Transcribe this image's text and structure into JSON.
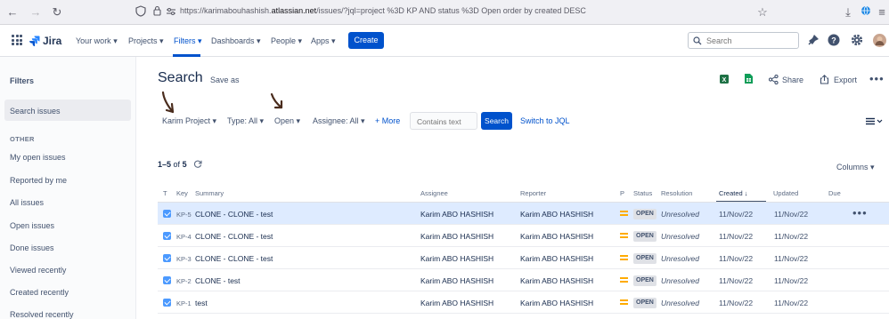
{
  "browser": {
    "url_prefix": "https://karimabouhashish.",
    "url_domain": "atlassian.net",
    "url_rest": "/issues/?jql=project %3D KP AND status %3D Open order by created DESC"
  },
  "nav": {
    "logo": "Jira",
    "your_work": "Your work ▾",
    "projects": "Projects ▾",
    "filters": "Filters ▾",
    "dashboards": "Dashboards ▾",
    "people": "People ▾",
    "apps": "Apps ▾",
    "create": "Create",
    "search_placeholder": "Search"
  },
  "sidebar": {
    "title": "Filters",
    "search_issues": "Search issues",
    "other_heading": "OTHER",
    "items": [
      "My open issues",
      "Reported by me",
      "All issues",
      "Open issues",
      "Done issues",
      "Viewed recently",
      "Created recently",
      "Resolved recently"
    ]
  },
  "main": {
    "title": "Search",
    "save_as": "Save as",
    "share": "Share",
    "export": "Export",
    "filters": {
      "project": "Karim Project ▾",
      "type": "Type: All ▾",
      "status": "Open ▾",
      "assignee": "Assignee: All ▾",
      "more": "+ More",
      "contains_placeholder": "Contains text",
      "search": "Search",
      "switch_jql": "Switch to JQL"
    },
    "count_range": "1–5",
    "count_of": "of",
    "count_total": "5",
    "columns": "Columns ▾"
  },
  "table": {
    "headers": {
      "t": "T",
      "key": "Key",
      "summary": "Summary",
      "assignee": "Assignee",
      "reporter": "Reporter",
      "p": "P",
      "status": "Status",
      "resolution": "Resolution",
      "created": "Created ↓",
      "updated": "Updated",
      "due": "Due"
    },
    "rows": [
      {
        "key": "KP-5",
        "summary": "CLONE - CLONE - test",
        "assignee": "Karim ABO HASHISH",
        "reporter": "Karim ABO HASHISH",
        "status": "OPEN",
        "resolution": "Unresolved",
        "created": "11/Nov/22",
        "updated": "11/Nov/22"
      },
      {
        "key": "KP-4",
        "summary": "CLONE - CLONE - test",
        "assignee": "Karim ABO HASHISH",
        "reporter": "Karim ABO HASHISH",
        "status": "OPEN",
        "resolution": "Unresolved",
        "created": "11/Nov/22",
        "updated": "11/Nov/22"
      },
      {
        "key": "KP-3",
        "summary": "CLONE - CLONE - test",
        "assignee": "Karim ABO HASHISH",
        "reporter": "Karim ABO HASHISH",
        "status": "OPEN",
        "resolution": "Unresolved",
        "created": "11/Nov/22",
        "updated": "11/Nov/22"
      },
      {
        "key": "KP-2",
        "summary": "CLONE - test",
        "assignee": "Karim ABO HASHISH",
        "reporter": "Karim ABO HASHISH",
        "status": "OPEN",
        "resolution": "Unresolved",
        "created": "11/Nov/22",
        "updated": "11/Nov/22"
      },
      {
        "key": "KP-1",
        "summary": "test",
        "assignee": "Karim ABO HASHISH",
        "reporter": "Karim ABO HASHISH",
        "status": "OPEN",
        "resolution": "Unresolved",
        "created": "11/Nov/22",
        "updated": "11/Nov/22"
      }
    ],
    "row_menu": "•••"
  },
  "colors": {
    "brand": "#0052cc",
    "selected_row": "#deebff",
    "priority_medium": "#ffab00",
    "annotation_arrow": "#4a2c1d"
  }
}
